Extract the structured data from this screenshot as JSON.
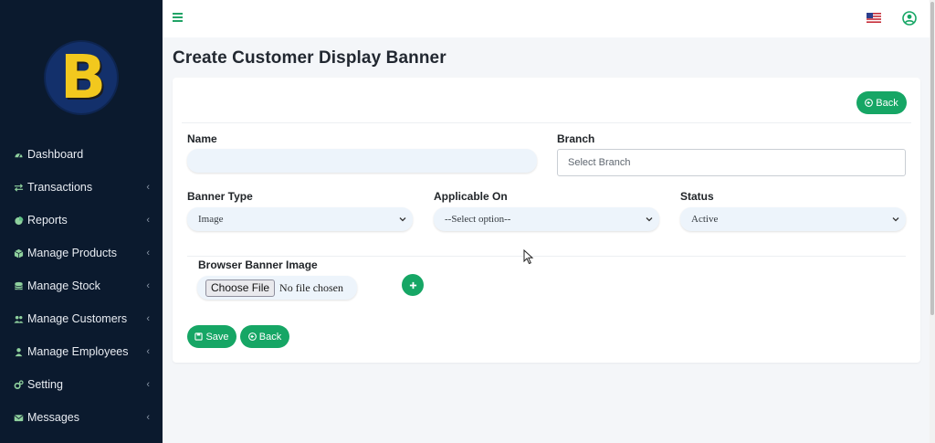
{
  "sidebar": {
    "logo_letter": "B",
    "items": [
      {
        "label": "Dashboard",
        "icon": "tachometer-icon",
        "has_submenu": false
      },
      {
        "label": "Transactions",
        "icon": "exchange-icon",
        "has_submenu": true
      },
      {
        "label": "Reports",
        "icon": "pie-chart-icon",
        "has_submenu": true
      },
      {
        "label": "Manage Products",
        "icon": "box-icon",
        "has_submenu": true
      },
      {
        "label": "Manage Stock",
        "icon": "database-icon",
        "has_submenu": true
      },
      {
        "label": "Manage Customers",
        "icon": "users-icon",
        "has_submenu": true
      },
      {
        "label": "Manage Employees",
        "icon": "user-icon",
        "has_submenu": true
      },
      {
        "label": "Setting",
        "icon": "cogs-icon",
        "has_submenu": true
      },
      {
        "label": "Messages",
        "icon": "envelope-icon",
        "has_submenu": true
      }
    ],
    "chevron": "‹"
  },
  "topbar": {
    "menu_icon": "hamburger-icon",
    "flag_icon": "us-flag-icon",
    "user_icon": "user-circle-icon"
  },
  "page": {
    "title": "Create Customer Display Banner"
  },
  "form": {
    "back_top_label": "Back",
    "name": {
      "label": "Name",
      "value": ""
    },
    "branch": {
      "label": "Branch",
      "placeholder": "Select Branch"
    },
    "banner_type": {
      "label": "Banner Type",
      "value": "Image"
    },
    "applicable_on": {
      "label": "Applicable On",
      "value": "--Select option--"
    },
    "status": {
      "label": "Status",
      "value": "Active"
    },
    "browser_image": {
      "label": "Browser Banner Image",
      "button": "Choose File",
      "file_text": "No file chosen"
    },
    "save_label": "Save",
    "back_label": "Back"
  },
  "colors": {
    "sidebar_bg": "#0b1a2e",
    "accent_green": "#16a665",
    "logo_yellow": "#f2c81e",
    "input_bg": "#edf4fb"
  }
}
